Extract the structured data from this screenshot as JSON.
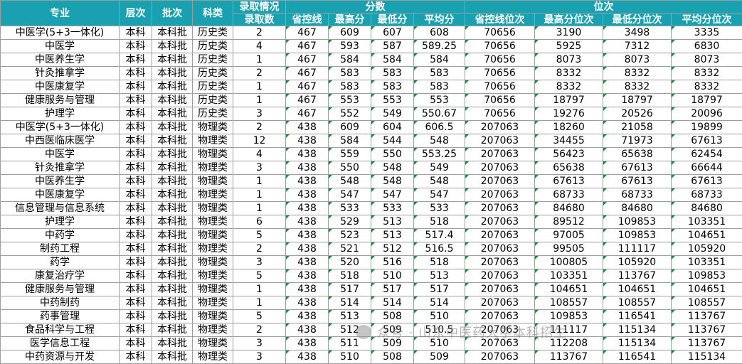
{
  "headers": {
    "major": "专业",
    "level": "层次",
    "batch": "批次",
    "category": "科类",
    "admit_group": "录取情况",
    "admit_count": "录取数",
    "scores": "分数",
    "ranks": "位次",
    "score_cols": [
      "省控线",
      "最高分",
      "最低分",
      "平均分"
    ],
    "rank_cols": [
      "省控线位次",
      "最高分位次",
      "最低分位次",
      "平均分位次"
    ]
  },
  "rows": [
    [
      "中医学(5+3一体化)",
      "本科",
      "本科批",
      "历史类",
      "2",
      "467",
      "609",
      "607",
      "608",
      "70656",
      "3190",
      "3498",
      "3335"
    ],
    [
      "中医学",
      "本科",
      "本科批",
      "历史类",
      "4",
      "467",
      "593",
      "587",
      "589.25",
      "70656",
      "5925",
      "7312",
      "6830"
    ],
    [
      "中医养生学",
      "本科",
      "本科批",
      "历史类",
      "1",
      "467",
      "584",
      "584",
      "584",
      "70656",
      "8073",
      "8073",
      "8073"
    ],
    [
      "针灸推拿学",
      "本科",
      "本科批",
      "历史类",
      "2",
      "467",
      "583",
      "583",
      "583",
      "70656",
      "8332",
      "8332",
      "8332"
    ],
    [
      "中医康复学",
      "本科",
      "本科批",
      "历史类",
      "1",
      "467",
      "583",
      "583",
      "583",
      "70656",
      "8332",
      "8332",
      "8332"
    ],
    [
      "健康服务与管理",
      "本科",
      "本科批",
      "历史类",
      "1",
      "467",
      "553",
      "553",
      "553",
      "70656",
      "18797",
      "18797",
      "18797"
    ],
    [
      "护理学",
      "本科",
      "本科批",
      "历史类",
      "3",
      "467",
      "552",
      "549",
      "550.67",
      "70656",
      "19276",
      "20526",
      "20096"
    ],
    [
      "中医学(5+3一体化)",
      "本科",
      "本科批",
      "物理类",
      "2",
      "438",
      "609",
      "604",
      "606.5",
      "207063",
      "18260",
      "21058",
      "19899"
    ],
    [
      "中西医临床医学",
      "本科",
      "本科批",
      "物理类",
      "12",
      "438",
      "584",
      "544",
      "548",
      "207063",
      "34455",
      "71973",
      "67613"
    ],
    [
      "中医学",
      "本科",
      "本科批",
      "物理类",
      "4",
      "438",
      "559",
      "550",
      "553.25",
      "207063",
      "56423",
      "65638",
      "62454"
    ],
    [
      "针灸推拿学",
      "本科",
      "本科批",
      "物理类",
      "3",
      "438",
      "550",
      "548",
      "549",
      "207063",
      "65638",
      "67613",
      "66644"
    ],
    [
      "中医养生学",
      "本科",
      "本科批",
      "物理类",
      "1",
      "438",
      "548",
      "548",
      "548",
      "207063",
      "67613",
      "67613",
      "67613"
    ],
    [
      "中医康复学",
      "本科",
      "本科批",
      "物理类",
      "1",
      "438",
      "547",
      "547",
      "547",
      "207063",
      "68733",
      "68733",
      "68733"
    ],
    [
      "信息管理与信息系统",
      "本科",
      "本科批",
      "物理类",
      "1",
      "438",
      "533",
      "533",
      "533",
      "207063",
      "84680",
      "84680",
      "84680"
    ],
    [
      "护理学",
      "本科",
      "本科批",
      "物理类",
      "6",
      "438",
      "529",
      "513",
      "518",
      "207063",
      "89512",
      "109853",
      "103351"
    ],
    [
      "中药学",
      "本科",
      "本科批",
      "物理类",
      "5",
      "438",
      "523",
      "513",
      "517.4",
      "207063",
      "97005",
      "109853",
      "104651"
    ],
    [
      "制药工程",
      "本科",
      "本科批",
      "物理类",
      "2",
      "438",
      "521",
      "512",
      "516.5",
      "207063",
      "99505",
      "111117",
      "105920"
    ],
    [
      "药学",
      "本科",
      "本科批",
      "物理类",
      "3",
      "438",
      "520",
      "516",
      "518",
      "207063",
      "100805",
      "105920",
      "103351"
    ],
    [
      "康复治疗学",
      "本科",
      "本科批",
      "物理类",
      "5",
      "438",
      "518",
      "510",
      "513",
      "207063",
      "103351",
      "113767",
      "109853"
    ],
    [
      "健康服务与管理",
      "本科",
      "本科批",
      "物理类",
      "1",
      "438",
      "517",
      "517",
      "517",
      "207063",
      "104651",
      "104651",
      "104651"
    ],
    [
      "中药制药",
      "本科",
      "本科批",
      "物理类",
      "1",
      "438",
      "514",
      "514",
      "514",
      "207063",
      "108557",
      "108557",
      "108557"
    ],
    [
      "药事管理",
      "本科",
      "本科批",
      "物理类",
      "5",
      "438",
      "513",
      "508",
      "510",
      "207063",
      "109853",
      "116541",
      "113767"
    ],
    [
      "食品科学与工程",
      "本科",
      "本科批",
      "物理类",
      "2",
      "438",
      "512",
      "509",
      "510.5",
      "207063",
      "111117",
      "115134",
      "113767"
    ],
    [
      "医学信息工程",
      "本科",
      "本科批",
      "物理类",
      "3",
      "438",
      "511",
      "509",
      "510",
      "207063",
      "112208",
      "115134",
      "113767"
    ],
    [
      "中药资源与开发",
      "本科",
      "本科批",
      "物理类",
      "3",
      "438",
      "510",
      "508",
      "509",
      "207063",
      "113767",
      "116541",
      "115134"
    ]
  ],
  "watermark": "众号 · 山东中医药大学本科招生"
}
